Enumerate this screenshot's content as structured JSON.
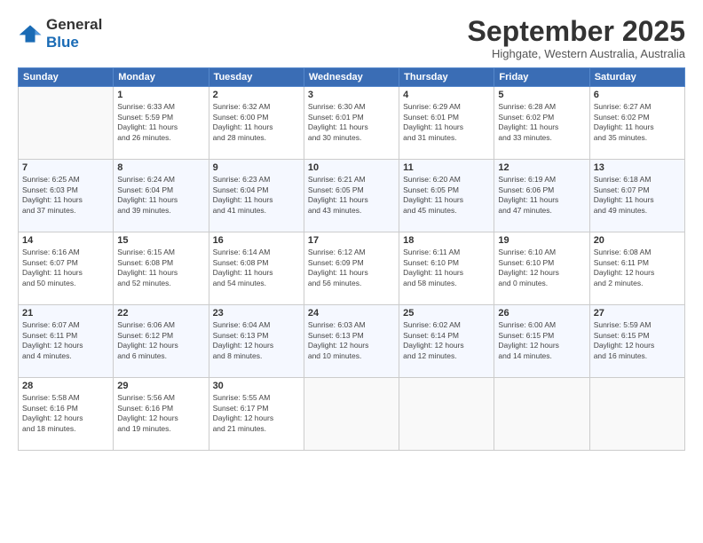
{
  "header": {
    "logo_general": "General",
    "logo_blue": "Blue",
    "title": "September 2025",
    "location": "Highgate, Western Australia, Australia"
  },
  "weekdays": [
    "Sunday",
    "Monday",
    "Tuesday",
    "Wednesday",
    "Thursday",
    "Friday",
    "Saturday"
  ],
  "weeks": [
    [
      {
        "day": "",
        "info": ""
      },
      {
        "day": "1",
        "info": "Sunrise: 6:33 AM\nSunset: 5:59 PM\nDaylight: 11 hours\nand 26 minutes."
      },
      {
        "day": "2",
        "info": "Sunrise: 6:32 AM\nSunset: 6:00 PM\nDaylight: 11 hours\nand 28 minutes."
      },
      {
        "day": "3",
        "info": "Sunrise: 6:30 AM\nSunset: 6:01 PM\nDaylight: 11 hours\nand 30 minutes."
      },
      {
        "day": "4",
        "info": "Sunrise: 6:29 AM\nSunset: 6:01 PM\nDaylight: 11 hours\nand 31 minutes."
      },
      {
        "day": "5",
        "info": "Sunrise: 6:28 AM\nSunset: 6:02 PM\nDaylight: 11 hours\nand 33 minutes."
      },
      {
        "day": "6",
        "info": "Sunrise: 6:27 AM\nSunset: 6:02 PM\nDaylight: 11 hours\nand 35 minutes."
      }
    ],
    [
      {
        "day": "7",
        "info": "Sunrise: 6:25 AM\nSunset: 6:03 PM\nDaylight: 11 hours\nand 37 minutes."
      },
      {
        "day": "8",
        "info": "Sunrise: 6:24 AM\nSunset: 6:04 PM\nDaylight: 11 hours\nand 39 minutes."
      },
      {
        "day": "9",
        "info": "Sunrise: 6:23 AM\nSunset: 6:04 PM\nDaylight: 11 hours\nand 41 minutes."
      },
      {
        "day": "10",
        "info": "Sunrise: 6:21 AM\nSunset: 6:05 PM\nDaylight: 11 hours\nand 43 minutes."
      },
      {
        "day": "11",
        "info": "Sunrise: 6:20 AM\nSunset: 6:05 PM\nDaylight: 11 hours\nand 45 minutes."
      },
      {
        "day": "12",
        "info": "Sunrise: 6:19 AM\nSunset: 6:06 PM\nDaylight: 11 hours\nand 47 minutes."
      },
      {
        "day": "13",
        "info": "Sunrise: 6:18 AM\nSunset: 6:07 PM\nDaylight: 11 hours\nand 49 minutes."
      }
    ],
    [
      {
        "day": "14",
        "info": "Sunrise: 6:16 AM\nSunset: 6:07 PM\nDaylight: 11 hours\nand 50 minutes."
      },
      {
        "day": "15",
        "info": "Sunrise: 6:15 AM\nSunset: 6:08 PM\nDaylight: 11 hours\nand 52 minutes."
      },
      {
        "day": "16",
        "info": "Sunrise: 6:14 AM\nSunset: 6:08 PM\nDaylight: 11 hours\nand 54 minutes."
      },
      {
        "day": "17",
        "info": "Sunrise: 6:12 AM\nSunset: 6:09 PM\nDaylight: 11 hours\nand 56 minutes."
      },
      {
        "day": "18",
        "info": "Sunrise: 6:11 AM\nSunset: 6:10 PM\nDaylight: 11 hours\nand 58 minutes."
      },
      {
        "day": "19",
        "info": "Sunrise: 6:10 AM\nSunset: 6:10 PM\nDaylight: 12 hours\nand 0 minutes."
      },
      {
        "day": "20",
        "info": "Sunrise: 6:08 AM\nSunset: 6:11 PM\nDaylight: 12 hours\nand 2 minutes."
      }
    ],
    [
      {
        "day": "21",
        "info": "Sunrise: 6:07 AM\nSunset: 6:11 PM\nDaylight: 12 hours\nand 4 minutes."
      },
      {
        "day": "22",
        "info": "Sunrise: 6:06 AM\nSunset: 6:12 PM\nDaylight: 12 hours\nand 6 minutes."
      },
      {
        "day": "23",
        "info": "Sunrise: 6:04 AM\nSunset: 6:13 PM\nDaylight: 12 hours\nand 8 minutes."
      },
      {
        "day": "24",
        "info": "Sunrise: 6:03 AM\nSunset: 6:13 PM\nDaylight: 12 hours\nand 10 minutes."
      },
      {
        "day": "25",
        "info": "Sunrise: 6:02 AM\nSunset: 6:14 PM\nDaylight: 12 hours\nand 12 minutes."
      },
      {
        "day": "26",
        "info": "Sunrise: 6:00 AM\nSunset: 6:15 PM\nDaylight: 12 hours\nand 14 minutes."
      },
      {
        "day": "27",
        "info": "Sunrise: 5:59 AM\nSunset: 6:15 PM\nDaylight: 12 hours\nand 16 minutes."
      }
    ],
    [
      {
        "day": "28",
        "info": "Sunrise: 5:58 AM\nSunset: 6:16 PM\nDaylight: 12 hours\nand 18 minutes."
      },
      {
        "day": "29",
        "info": "Sunrise: 5:56 AM\nSunset: 6:16 PM\nDaylight: 12 hours\nand 19 minutes."
      },
      {
        "day": "30",
        "info": "Sunrise: 5:55 AM\nSunset: 6:17 PM\nDaylight: 12 hours\nand 21 minutes."
      },
      {
        "day": "",
        "info": ""
      },
      {
        "day": "",
        "info": ""
      },
      {
        "day": "",
        "info": ""
      },
      {
        "day": "",
        "info": ""
      }
    ]
  ]
}
